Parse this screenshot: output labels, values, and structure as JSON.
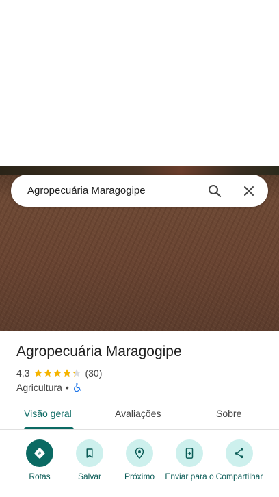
{
  "search": {
    "query": "Agropecuária Maragogipe"
  },
  "place": {
    "title": "Agropecuária Maragogipe",
    "rating": "4,3",
    "stars": 4.3,
    "review_count": "(30)",
    "category": "Agricultura",
    "separator": "•"
  },
  "tabs": [
    {
      "label": "Visão geral",
      "active": true
    },
    {
      "label": "Avaliações",
      "active": false
    },
    {
      "label": "Sobre",
      "active": false
    }
  ],
  "actions": [
    {
      "label": "Rotas",
      "icon": "directions-icon"
    },
    {
      "label": "Salvar",
      "icon": "bookmark-icon"
    },
    {
      "label": "Próximo",
      "icon": "nearby-icon"
    },
    {
      "label": "Enviar para o",
      "icon": "send-to-phone-icon"
    },
    {
      "label": "Compartilhar",
      "icon": "share-icon"
    }
  ],
  "colors": {
    "accent": "#0b6a63",
    "action_bg": "#cdf0ed",
    "star": "#f5b400",
    "accessibility": "#1a73e8"
  }
}
